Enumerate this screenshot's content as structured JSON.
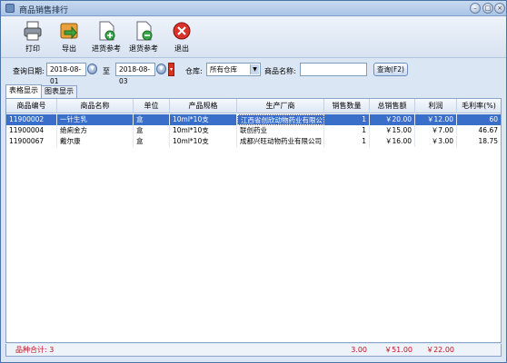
{
  "window": {
    "title": "商品销售排行"
  },
  "toolbar": [
    {
      "label": "打印",
      "icon": "printer-icon"
    },
    {
      "label": "导出",
      "icon": "export-icon"
    },
    {
      "label": "进货参考",
      "icon": "add-document-icon"
    },
    {
      "label": "退货参考",
      "icon": "remove-document-icon"
    },
    {
      "label": "退出",
      "icon": "close-icon"
    }
  ],
  "filters": {
    "date_label": "查询日期:",
    "date_from": "2018-08-01",
    "to_label": "至",
    "date_to": "2018-08-03",
    "warehouse_label": "仓库:",
    "warehouse_value": "所有仓库",
    "product_label": "商品名称:",
    "product_value": "",
    "query_button": "查询(F2)"
  },
  "tabs": [
    {
      "label": "表格显示",
      "active": true
    },
    {
      "label": "图表显示",
      "active": false
    }
  ],
  "table": {
    "columns": [
      "商品编号",
      "商品名称",
      "单位",
      "产品规格",
      "生产厂商",
      "销售数量",
      "总销售额",
      "利润",
      "毛利率(%)"
    ],
    "rows": [
      {
        "code": "11900002",
        "name": "一针生乳",
        "unit": "盒",
        "spec": "10ml*10支",
        "maker": "江西省创欣动物药业有限公司",
        "qty": "1",
        "total": "￥20.00",
        "profit": "￥12.00",
        "margin": "60",
        "selected": true
      },
      {
        "code": "11900004",
        "name": "绝痢金方",
        "unit": "盒",
        "spec": "10ml*10支",
        "maker": "联创药业",
        "qty": "1",
        "total": "￥15.00",
        "profit": "￥7.00",
        "margin": "46.67",
        "selected": false
      },
      {
        "code": "11900067",
        "name": "戴尔康",
        "unit": "盒",
        "spec": "10ml*10支",
        "maker": "成都兴旺动物药业有限公司",
        "qty": "1",
        "total": "￥16.00",
        "profit": "￥3.00",
        "margin": "18.75",
        "selected": false
      }
    ]
  },
  "footer": {
    "count_label": "品种合计: 3",
    "qty_total": "3.00",
    "sales_total": "￥51.00",
    "profit_total": "￥22.00"
  },
  "colors": {
    "accent": "#3a6fc9",
    "footer_text": "#c1121f"
  }
}
